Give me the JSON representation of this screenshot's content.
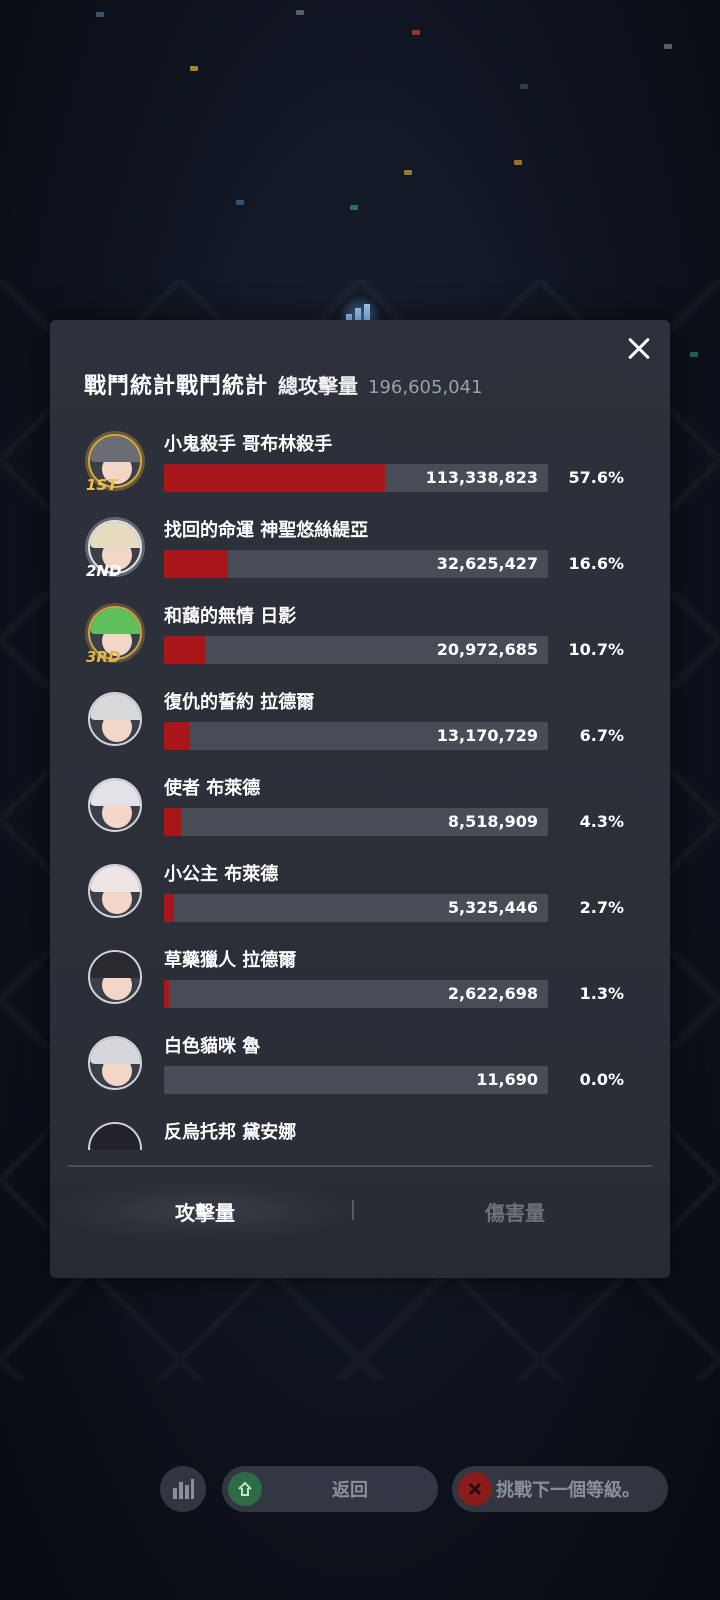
{
  "panel": {
    "title": "戰鬥統計戰鬥統計",
    "total_label": "總攻擊量",
    "total_value": "196,605,041"
  },
  "accent": {
    "bar_fill": "#a8161a",
    "bar_track": "#474c56",
    "gold": "#f1c04e"
  },
  "rows": [
    {
      "name": "小鬼殺手 哥布林殺手",
      "value": "113,338,823",
      "percent": "57.6%",
      "fraction": 0.576,
      "rank": "1ST",
      "hair": "#6a6d73"
    },
    {
      "name": "找回的命運 神聖悠絲緹亞",
      "value": "32,625,427",
      "percent": "16.6%",
      "fraction": 0.166,
      "rank": "2ND",
      "hair": "#e8dcc0"
    },
    {
      "name": "和藹的無情 日影",
      "value": "20,972,685",
      "percent": "10.7%",
      "fraction": 0.107,
      "rank": "3RD",
      "hair": "#5fbf5a"
    },
    {
      "name": "復仇的誓約 拉德爾",
      "value": "13,170,729",
      "percent": "6.7%",
      "fraction": 0.067,
      "rank": "",
      "hair": "#d9d9dc"
    },
    {
      "name": "使者 布萊德",
      "value": "8,518,909",
      "percent": "4.3%",
      "fraction": 0.043,
      "rank": "",
      "hair": "#e4e2e6"
    },
    {
      "name": "小公主 布萊德",
      "value": "5,325,446",
      "percent": "2.7%",
      "fraction": 0.027,
      "rank": "",
      "hair": "#efe4e4"
    },
    {
      "name": "草藥獵人 拉德爾",
      "value": "2,622,698",
      "percent": "1.3%",
      "fraction": 0.013,
      "rank": "",
      "hair": "#2a2a2e"
    },
    {
      "name": "白色貓咪 魯",
      "value": "11,690",
      "percent": "0.0%",
      "fraction": 0.0,
      "rank": "",
      "hair": "#d8d8dc"
    },
    {
      "name": "反烏托邦 黛安娜",
      "value": "",
      "percent": "",
      "fraction": 0.0,
      "rank": "",
      "hair": "#222228"
    }
  ],
  "tabs": {
    "attack": "攻擊量",
    "damage": "傷害量"
  },
  "bottom": {
    "back_label": "返回",
    "next_label": "挑戰下一個等級。"
  },
  "icons": {
    "stats": "bar-chart-icon",
    "close": "close-icon",
    "back": "return-icon",
    "next": "blocked-icon"
  }
}
